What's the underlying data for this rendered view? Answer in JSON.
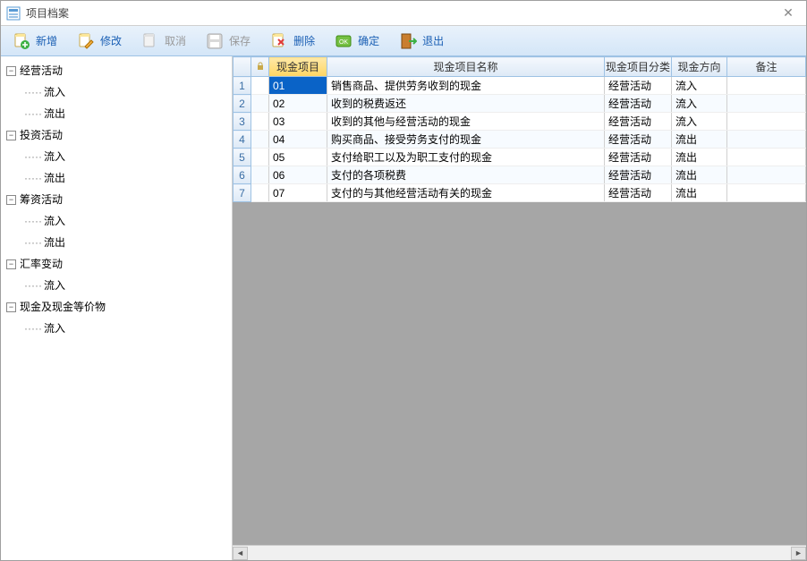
{
  "window": {
    "title": "项目档案",
    "close_glyph": "✕"
  },
  "toolbar": {
    "add": "新增",
    "edit": "修改",
    "cancel": "取消",
    "save": "保存",
    "delete": "删除",
    "ok": "确定",
    "exit": "退出"
  },
  "tree": [
    {
      "label": "经营活动",
      "children": [
        "流入",
        "流出"
      ]
    },
    {
      "label": "投资活动",
      "children": [
        "流入",
        "流出"
      ]
    },
    {
      "label": "筹资活动",
      "children": [
        "流入",
        "流出"
      ]
    },
    {
      "label": "汇率变动",
      "children": [
        "流入"
      ]
    },
    {
      "label": "现金及现金等价物",
      "children": [
        "流入"
      ]
    }
  ],
  "grid": {
    "columns": {
      "lock": "",
      "code": "现金项目",
      "name": "现金项目名称",
      "category": "现金项目分类",
      "direction": "现金方向",
      "remark": "备注"
    },
    "rows": [
      {
        "n": "1",
        "code": "01",
        "name": "销售商品、提供劳务收到的现金",
        "cat": "经营活动",
        "dir": "流入",
        "remark": "",
        "selected": true
      },
      {
        "n": "2",
        "code": "02",
        "name": "收到的税费返还",
        "cat": "经营活动",
        "dir": "流入",
        "remark": ""
      },
      {
        "n": "3",
        "code": "03",
        "name": "收到的其他与经营活动的现金",
        "cat": "经营活动",
        "dir": "流入",
        "remark": ""
      },
      {
        "n": "4",
        "code": "04",
        "name": "购买商品、接受劳务支付的现金",
        "cat": "经营活动",
        "dir": "流出",
        "remark": ""
      },
      {
        "n": "5",
        "code": "05",
        "name": "支付给职工以及为职工支付的现金",
        "cat": "经营活动",
        "dir": "流出",
        "remark": ""
      },
      {
        "n": "6",
        "code": "06",
        "name": "支付的各项税费",
        "cat": "经营活动",
        "dir": "流出",
        "remark": ""
      },
      {
        "n": "7",
        "code": "07",
        "name": "支付的与其他经营活动有关的现金",
        "cat": "经营活动",
        "dir": "流出",
        "remark": ""
      }
    ]
  }
}
